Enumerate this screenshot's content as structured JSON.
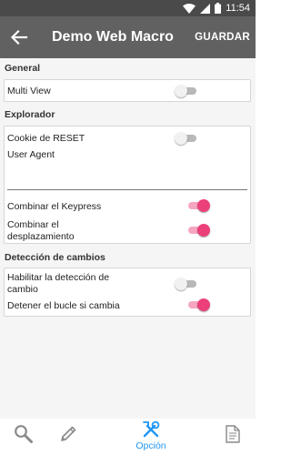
{
  "status_bar": {
    "time": "11:54",
    "icons": [
      "wifi-icon",
      "signal-icon",
      "battery-icon"
    ]
  },
  "app_bar": {
    "title": "Demo Web Macro",
    "save_label": "GUARDAR",
    "back_icon": "arrow-back-icon"
  },
  "sections": {
    "general": {
      "title": "General",
      "multi_view": {
        "label": "Multi View",
        "checked": false
      }
    },
    "explorador": {
      "title": "Explorador",
      "cookie_reset": {
        "label": "Cookie de RESET",
        "checked": false
      },
      "user_agent": {
        "label": "User Agent",
        "value": "",
        "placeholder": ""
      },
      "combine_keypress": {
        "label": "Combinar el Keypress",
        "checked": true
      },
      "combine_scroll": {
        "label": "Combinar el desplazamiento",
        "checked": true
      }
    },
    "deteccion": {
      "title": "Detección de cambios",
      "enable_detection": {
        "label": "Habilitar la detección de cambio",
        "checked": false
      },
      "stop_loop": {
        "label": "Detener el bucle si cambia",
        "checked": true
      }
    }
  },
  "bottom_nav": {
    "items": [
      {
        "icon": "search-icon",
        "label": ""
      },
      {
        "icon": "pencil-icon",
        "label": ""
      },
      {
        "icon": "tools-icon",
        "label": "Opción",
        "active": true
      },
      {
        "icon": "document-icon",
        "label": ""
      }
    ]
  },
  "colors": {
    "app_bar": "#616161",
    "status_bar": "#4a4a4a",
    "accent": "#ec407a",
    "nav_active": "#2196f3"
  }
}
